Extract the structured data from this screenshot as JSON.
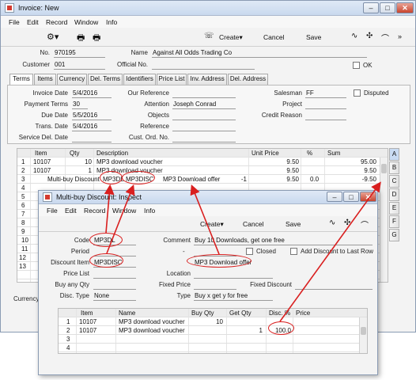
{
  "main_window": {
    "title": "Invoice: New",
    "menu": [
      "File",
      "Edit",
      "Record",
      "Window",
      "Info"
    ],
    "toolbar": {
      "create": "Create",
      "cancel": "Cancel",
      "save": "Save"
    },
    "header": {
      "no_label": "No.",
      "no_value": "970195",
      "name_label": "Name",
      "name_value": "Against All Odds Trading Co",
      "customer_label": "Customer",
      "customer_value": "001",
      "official_label": "Official No.",
      "official_value": "",
      "ok_label": "OK"
    },
    "tabs": [
      "Terms",
      "Items",
      "Currency",
      "Del. Terms",
      "Identifiers",
      "Price List",
      "Inv. Address",
      "Del. Address"
    ],
    "terms": {
      "invoice_date_label": "Invoice Date",
      "invoice_date": "5/4/2016",
      "our_ref_label": "Our Reference",
      "our_ref": "",
      "salesman_label": "Salesman",
      "salesman": "FF",
      "disputed_label": "Disputed",
      "payment_terms_label": "Payment Terms",
      "payment_terms": "30",
      "attention_label": "Attention",
      "attention": "Joseph Conrad",
      "project_label": "Project",
      "project": "",
      "due_date_label": "Due Date",
      "due_date": "5/5/2016",
      "objects_label": "Objects",
      "objects": "",
      "credit_reason_label": "Credit Reason",
      "credit_reason": "",
      "trans_date_label": "Trans. Date",
      "trans_date": "5/4/2016",
      "reference_label": "Reference",
      "reference": "",
      "service_del_label": "Service Del. Date",
      "service_del": "",
      "cust_ord_label": "Cust. Ord. No.",
      "cust_ord": ""
    },
    "grid": {
      "headers": [
        "Item",
        "Qty",
        "Description",
        "Unit Price",
        "%",
        "Sum"
      ],
      "rows": [
        {
          "n": "1",
          "item": "10107",
          "qty": "10",
          "desc": "MP3 download voucher",
          "unit_price": "9.50",
          "pct": "",
          "sum": "95.00"
        },
        {
          "n": "2",
          "item": "10107",
          "qty": "1",
          "desc": "MP3 download voucher",
          "unit_price": "9.50",
          "pct": "",
          "sum": "9.50"
        },
        {
          "n": "3",
          "item": "Multi-buy Discount",
          "qty": "MP3DL",
          "desc": "MP3DISC",
          "extra": "MP3 Download offer",
          "qty2": "-1",
          "unit_price": "9.50",
          "pct": "0.0",
          "sum": "-9.50"
        }
      ],
      "row_numbers": [
        "4",
        "5",
        "6",
        "7",
        "8",
        "9",
        "10",
        "11",
        "12",
        "13"
      ],
      "side_tabs": [
        "A",
        "B",
        "C",
        "D",
        "E",
        "F",
        "G"
      ]
    },
    "currency_label": "Currency"
  },
  "dialog": {
    "title": "Multi-buy Discount: Inspect",
    "menu": [
      "File",
      "Edit",
      "Record",
      "Window",
      "Info"
    ],
    "toolbar": {
      "create": "Create",
      "cancel": "Cancel",
      "save": "Save"
    },
    "fields": {
      "code_label": "Code",
      "code": "MP3DL",
      "comment_label": "Comment",
      "comment": "Buy 10 Downloads, get one free",
      "period_label": "Period",
      "period_sep": "-",
      "closed_label": "Closed",
      "add_discount_label": "Add Discount to Last Row",
      "discount_item_label": "Discount Item",
      "discount_item": "MP3DISC",
      "discount_item_desc": "MP3 Download offer",
      "price_list_label": "Price List",
      "price_list": "",
      "location_label": "Location",
      "location": "",
      "buy_any_label": "Buy any Qty",
      "buy_any": "",
      "fixed_price_label": "Fixed Price",
      "fixed_price": "",
      "fixed_discount_label": "Fixed Discount",
      "fixed_discount": "",
      "disc_type_label": "Disc. Type",
      "disc_type": "None",
      "type_label": "Type",
      "type": "Buy x get y for free"
    },
    "grid": {
      "headers": [
        "Item",
        "Name",
        "Buy Qty",
        "Get Qty",
        "Disc. %",
        "Price"
      ],
      "rows": [
        {
          "n": "1",
          "item": "10107",
          "name": "MP3 download voucher",
          "buy": "10",
          "get": "",
          "disc": "",
          "price": ""
        },
        {
          "n": "2",
          "item": "10107",
          "name": "MP3 download voucher",
          "buy": "",
          "get": "1",
          "disc": "100.0",
          "price": ""
        },
        {
          "n": "3",
          "item": "",
          "name": "",
          "buy": "",
          "get": "",
          "disc": "",
          "price": ""
        },
        {
          "n": "4",
          "item": "",
          "name": "",
          "buy": "",
          "get": "",
          "disc": "",
          "price": ""
        }
      ]
    }
  },
  "colors": {
    "annotation_red": "#d91f1f",
    "title_gradient": "#c9d9ee",
    "close_button": "#c9442e"
  }
}
